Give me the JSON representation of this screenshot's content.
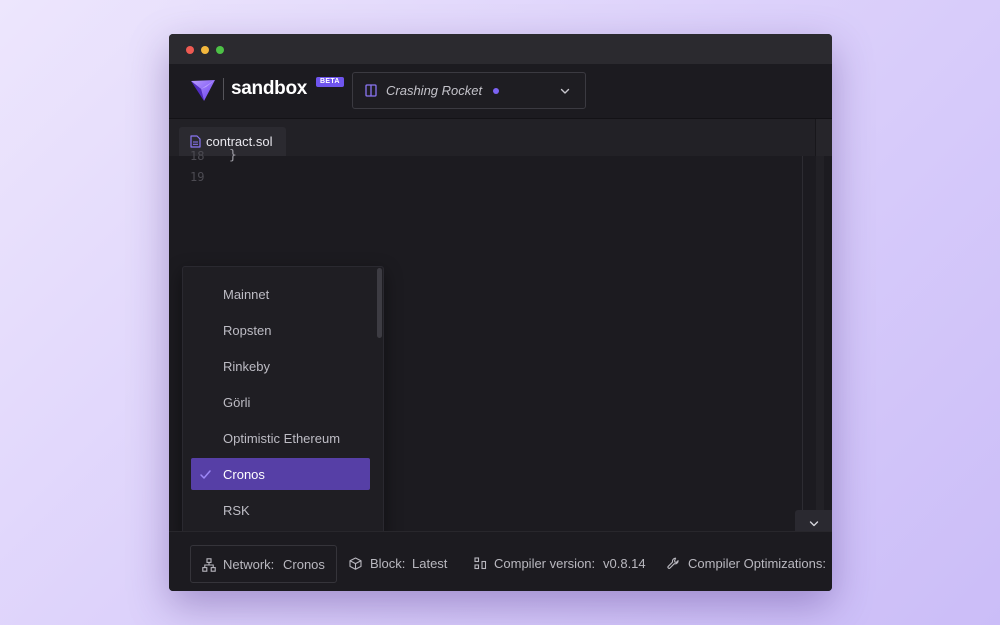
{
  "app": {
    "brand": "sandbox",
    "badge": "BETA"
  },
  "project": {
    "name": "Crashing Rocket",
    "status_color": "#7c63f3"
  },
  "icons": {
    "logo": "sandbox-logo",
    "project": "book-icon",
    "project_menu": "chevron-down-icon",
    "tab": "file-icon",
    "network": "network-icon",
    "block": "cube-icon",
    "compiler": "compiler-icon",
    "optimizations": "wrench-icon",
    "selected": "check-icon"
  },
  "tabs": [
    {
      "label": "contract.sol",
      "active": true
    }
  ],
  "editor": {
    "line_numbers": [
      "18",
      "19"
    ],
    "partial_code": "}"
  },
  "network_menu": {
    "items": [
      {
        "label": "Mainnet",
        "selected": false
      },
      {
        "label": "Ropsten",
        "selected": false
      },
      {
        "label": "Rinkeby",
        "selected": false
      },
      {
        "label": "Görli",
        "selected": false
      },
      {
        "label": "Optimistic Ethereum",
        "selected": false
      },
      {
        "label": "Cronos",
        "selected": true
      },
      {
        "label": "RSK",
        "selected": false
      }
    ]
  },
  "statusbar": {
    "network_label": "Network:",
    "network_value": "Cronos",
    "block_label": "Block:",
    "block_value": "Latest",
    "compiler_label": "Compiler version:",
    "compiler_value": "v0.8.14",
    "optimizations_label": "Compiler Optimizations:"
  },
  "colors": {
    "accent": "#6f55ee",
    "selected_bg": "#563fa6",
    "window_bg": "#1c1b20"
  }
}
